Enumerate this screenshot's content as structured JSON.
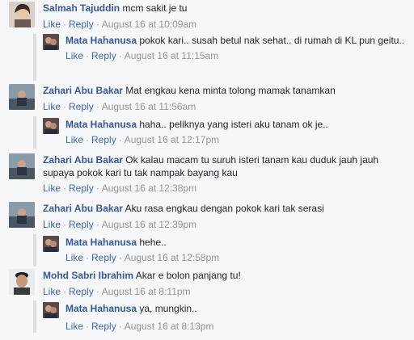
{
  "comments": [
    {
      "author": "Salmah Tajuddin",
      "text": "mcm sakit je tu",
      "like": "Like",
      "reply": "Reply",
      "time": "August 16 at 10:09am"
    },
    {
      "author": "Mata Hahanusa",
      "text": "pokok kari.. susah betul nak sehat.. di rumah di KL pun geitu..",
      "like": "Like",
      "reply": "Reply",
      "time": "August 16 at 11:15am"
    },
    {
      "author": "Zahari Abu Bakar",
      "text": "Mat engkau kena minta tolong mamak tanamkan",
      "like": "Like",
      "reply": "Reply",
      "time": "August 16 at 11:56am"
    },
    {
      "author": "Mata Hahanusa",
      "text": "haha.. peliknyа yang isteri aku tanam ok je..",
      "like": "Like",
      "reply": "Reply",
      "time": "August 16 at 12:17pm"
    },
    {
      "author": "Zahari Abu Bakar",
      "text": "Ok kalau macam tu suruh isteri tanam kau duduk jauh jauh supaya pokok kari tu tak nampak bayang kau",
      "like": "Like",
      "reply": "Reply",
      "time": "August 16 at 12:38pm"
    },
    {
      "author": "Zahari Abu Bakar",
      "text": "Aku rasa engkau dengan pokok kari tak serasi",
      "like": "Like",
      "reply": "Reply",
      "time": "August 16 at 12:39pm"
    },
    {
      "author": "Mata Hahanusa",
      "text": "hehe..",
      "like": "Like",
      "reply": "Reply",
      "time": "August 16 at 12:58pm"
    },
    {
      "author": "Mohd Sabri Ibrahim",
      "text": "Akar e bolon panjang tu!",
      "like": "Like",
      "reply": "Reply",
      "time": "August 16 at 8:11pm"
    },
    {
      "author": "Mata Hahanusa",
      "text": "ya, mungkin..",
      "like": "Like",
      "reply": "Reply",
      "time": "August 16 at 8:13pm"
    }
  ],
  "separator": "·"
}
